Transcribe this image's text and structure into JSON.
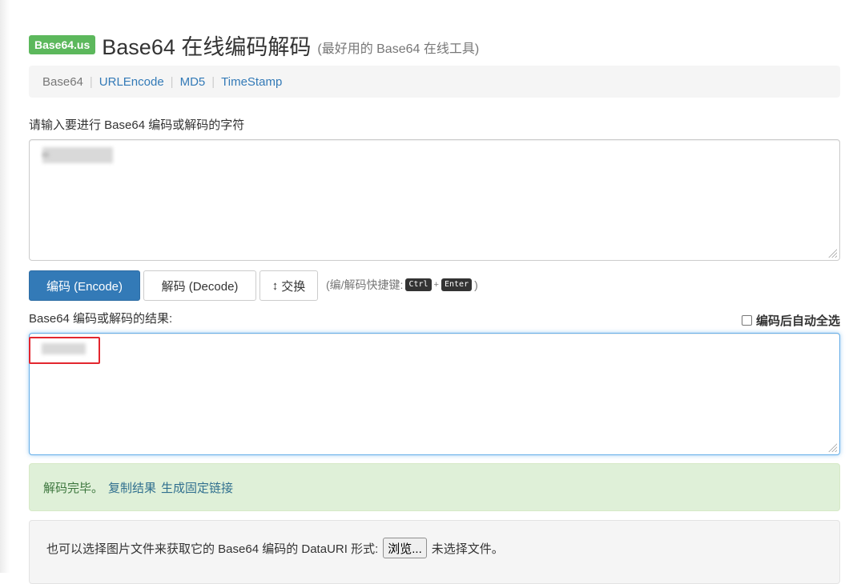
{
  "header": {
    "brand_badge": "Base64.us",
    "title": "Base64 在线编码解码",
    "subtitle": "(最好用的 Base64 在线工具)"
  },
  "nav": {
    "items": [
      {
        "label": "Base64",
        "active": true
      },
      {
        "label": "URLEncode",
        "active": false
      },
      {
        "label": "MD5",
        "active": false
      },
      {
        "label": "TimeStamp",
        "active": false
      }
    ],
    "separator": "|"
  },
  "input": {
    "label": "请输入要进行 Base64 编码或解码的字符",
    "value_obscured": true
  },
  "actions": {
    "encode_label": "编码 (Encode)",
    "decode_label": "解码 (Decode)",
    "swap_label": "交换",
    "shortcut_prefix": "(编/解码快捷键:",
    "shortcut_key1": "Ctrl",
    "shortcut_plus": "+",
    "shortcut_key2": "Enter",
    "shortcut_suffix": ")"
  },
  "output": {
    "label": "Base64 编码或解码的结果:",
    "autoselect_label": "编码后自动全选",
    "autoselect_checked": false,
    "value_obscured": true
  },
  "status": {
    "message": "解码完毕。",
    "copy_link": "复制结果",
    "permalink_link": "生成固定链接"
  },
  "file": {
    "prompt": "也可以选择图片文件来获取它的 Base64 编码的 DataURI 形式:",
    "browse_label": "浏览...",
    "no_file_label": "未选择文件。"
  },
  "colors": {
    "brand_green": "#5cb85c",
    "primary_blue": "#337ab7",
    "link_blue": "#337ab7",
    "success_bg": "#dff0d8",
    "highlight_red": "#e3262e"
  }
}
